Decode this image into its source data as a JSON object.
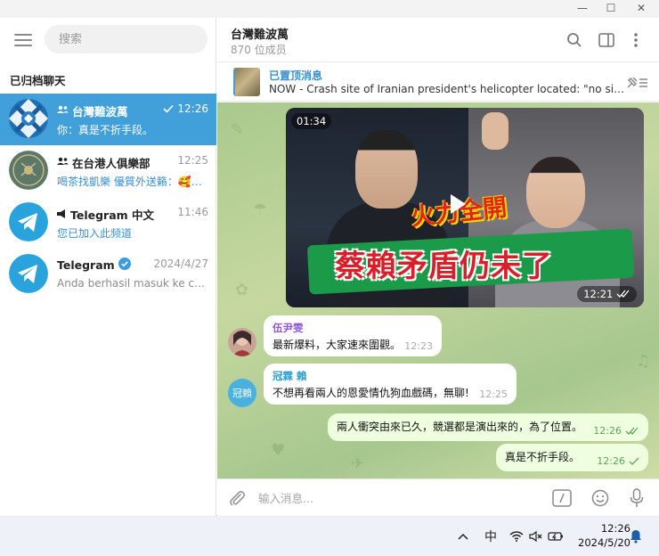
{
  "window": {
    "minimize_glyph": "—",
    "maximize_glyph": "☐",
    "close_glyph": "✕"
  },
  "sidebar": {
    "search_placeholder": "搜索",
    "section_title": "已归档聊天",
    "chats": [
      {
        "name": "台灣難波萬",
        "time": "12:26",
        "preview": "你：真是不折手段。",
        "active": true,
        "type": "group"
      },
      {
        "name": "在台港人俱樂部",
        "time": "12:25",
        "preview": "喝茶找凱樂 優質外送籟：🥰gz...",
        "type": "group"
      },
      {
        "name": "Telegram 中文",
        "time": "11:46",
        "preview": "您已加入此频道",
        "type": "channel"
      },
      {
        "name": "Telegram",
        "time": "2024/4/27",
        "preview": "Anda berhasil masuk ke cap...",
        "type": "verified"
      }
    ]
  },
  "header": {
    "title": "台灣難波萬",
    "subtitle": "870 位成员"
  },
  "pinned": {
    "title": "已置顶消息",
    "text": "NOW - Crash site of Iranian president's helicopter located: \"no sign..."
  },
  "video": {
    "duration": "01:34",
    "time": "12:21",
    "caption_top": "火力全開",
    "caption_main": "蔡賴矛盾仍未了"
  },
  "messages": [
    {
      "sender": "伍尹雯",
      "text": "最新爆料，大家速來圍觀。",
      "time": "12:23",
      "sender_color": "#8e5bd0"
    },
    {
      "sender": "冠霖 賴",
      "text": "不想再看兩人的恩愛情仇狗血戲碼，無聊!",
      "time": "12:25",
      "sender_color": "#2f9fd0",
      "avatar_text": "冠賴"
    },
    {
      "text": "兩人衝突由來已久，競選都是演出來的，為了位置。",
      "time": "12:26"
    },
    {
      "text": "真是不折手段。",
      "time": "12:26"
    }
  ],
  "composer": {
    "placeholder": "输入消息..."
  },
  "taskbar": {
    "time": "12:26",
    "date": "2024/5/20",
    "ime": "中"
  }
}
